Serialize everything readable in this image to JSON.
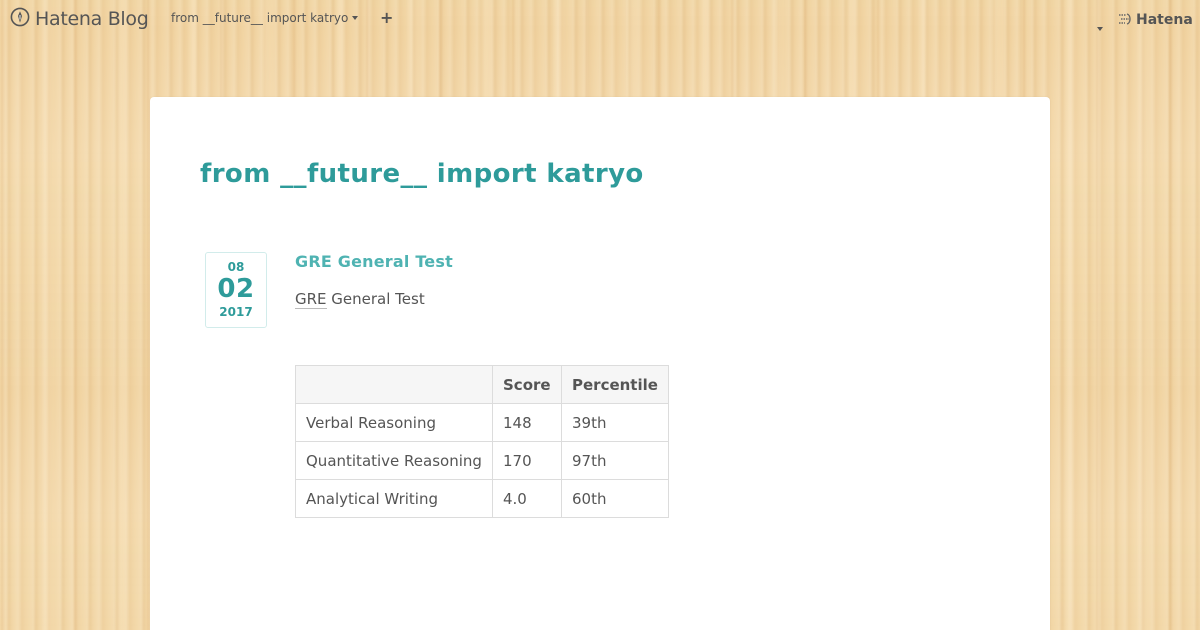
{
  "topbar": {
    "brand_label": "Hatena Blog",
    "brand_icon": "hatena-blog-pen-icon",
    "blog_switcher_label": "from __future__ import katryo",
    "new_post_label": "+",
    "hatena_label": "Hatena",
    "hatena_icon": "hatena-logo-icon"
  },
  "blog": {
    "title": "from __future__ import katryo"
  },
  "entry": {
    "date": {
      "month": "08",
      "day": "02",
      "year": "2017"
    },
    "title": "GRE General Test",
    "body": {
      "abbr": "GRE",
      "rest": " General Test"
    },
    "table": {
      "headers": [
        "",
        "Score",
        "Percentile"
      ],
      "rows": [
        [
          "Verbal Reasoning",
          "148",
          "39th"
        ],
        [
          "Quantitative Reasoning",
          "170",
          "97th"
        ],
        [
          "Analytical Writing",
          "4.0",
          "60th"
        ]
      ]
    }
  },
  "colors": {
    "accent": "#2e9b9a",
    "entry_title": "#4fb3b2",
    "text": "#555555",
    "wood_background": "#f3d8a8"
  }
}
